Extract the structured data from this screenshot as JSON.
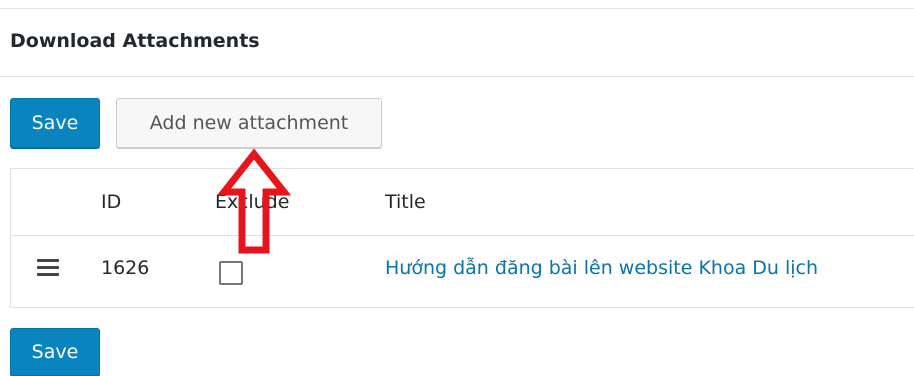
{
  "panel": {
    "title": "Download Attachments"
  },
  "toolbar": {
    "save_label": "Save",
    "add_label": "Add new attachment"
  },
  "table": {
    "columns": {
      "id": "ID",
      "exclude": "Exclude",
      "title": "Title"
    },
    "rows": [
      {
        "id": "1626",
        "exclude": false,
        "title": "Hướng dẫn đăng bài lên website Khoa Du lịch"
      }
    ]
  },
  "footer": {
    "save_label": "Save"
  },
  "colors": {
    "primary_button": "#0a84bf",
    "link": "#0a73aa",
    "annotation_arrow": "#e8141c"
  },
  "icons": {
    "drag_handle": "hamburger-icon",
    "annotation": "arrow-up-icon"
  }
}
